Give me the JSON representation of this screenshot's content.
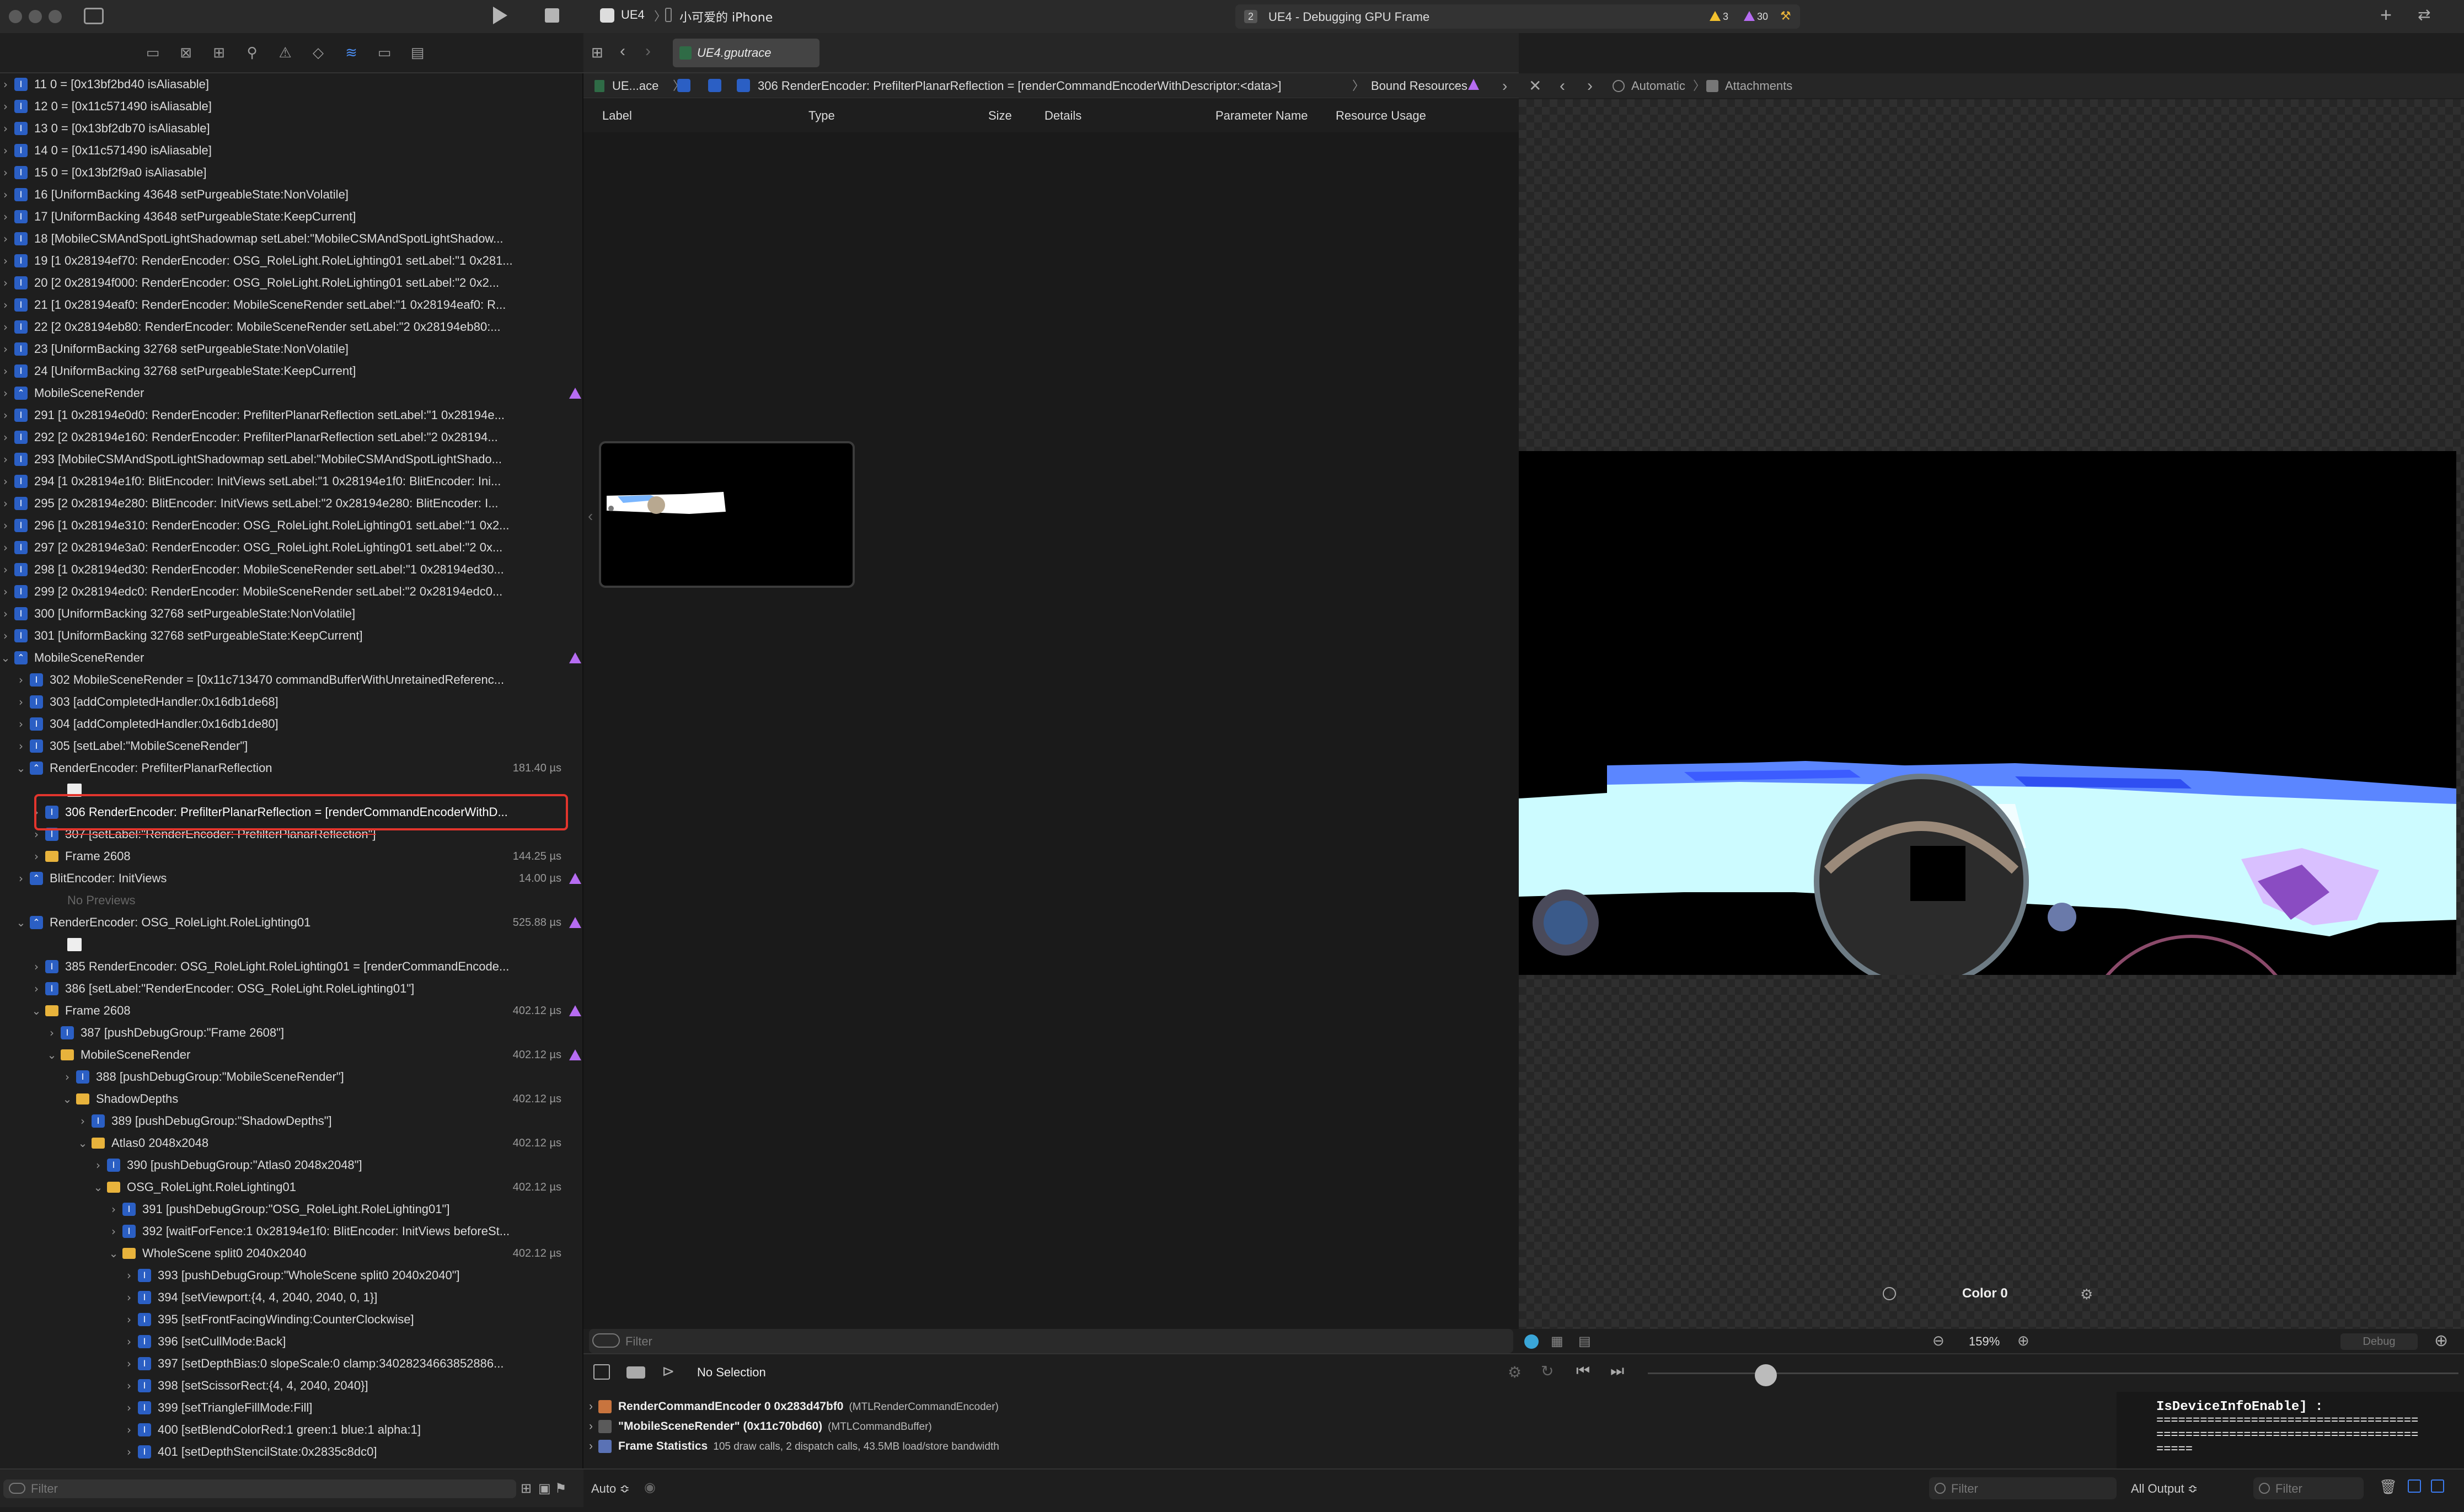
{
  "toolbar": {
    "scheme": "UE4",
    "device": "小可爱的 iPhone",
    "activity_num": "2",
    "activity": "UE4 - Debugging GPU Frame",
    "warnings": "3",
    "issues": "30"
  },
  "tab": {
    "title": "UE4.gputrace"
  },
  "breadcrumb": {
    "root": "UE...ace",
    "item": "306 RenderEncoder: PrefilterPlanarReflection = [renderCommandEncoderWithDescriptor:<data>]",
    "section": "Bound Resources"
  },
  "right_breadcrumb": {
    "mode": "Automatic",
    "item": "Attachments"
  },
  "columns": [
    "Label",
    "Type",
    "Size",
    "Details",
    "Parameter Name",
    "Resource Usage"
  ],
  "rows": [
    {
      "t": "11 0 = [0x13bf2bd40 isAliasable]",
      "d": 0,
      "i": "cmd"
    },
    {
      "t": "12 0 = [0x11c571490 isAliasable]",
      "d": 0,
      "i": "cmd"
    },
    {
      "t": "13 0 = [0x13bf2db70 isAliasable]",
      "d": 0,
      "i": "cmd"
    },
    {
      "t": "14 0 = [0x11c571490 isAliasable]",
      "d": 0,
      "i": "cmd"
    },
    {
      "t": "15 0 = [0x13bf2f9a0 isAliasable]",
      "d": 0,
      "i": "cmd"
    },
    {
      "t": "16 [UniformBacking 43648 setPurgeableState:NonVolatile]",
      "d": 0,
      "i": "cmd"
    },
    {
      "t": "17 [UniformBacking 43648 setPurgeableState:KeepCurrent]",
      "d": 0,
      "i": "cmd"
    },
    {
      "t": "18 [MobileCSMAndSpotLightShadowmap setLabel:\"MobileCSMAndSpotLightShadow...",
      "d": 0,
      "i": "cmd"
    },
    {
      "t": "19 [1 0x28194ef70: RenderEncoder: OSG_RoleLight.RoleLighting01 setLabel:\"1 0x281...",
      "d": 0,
      "i": "cmd"
    },
    {
      "t": "20 [2 0x28194f000: RenderEncoder: OSG_RoleLight.RoleLighting01 setLabel:\"2 0x2...",
      "d": 0,
      "i": "cmd"
    },
    {
      "t": "21 [1 0x28194eaf0: RenderEncoder: MobileSceneRender setLabel:\"1 0x28194eaf0: R...",
      "d": 0,
      "i": "cmd"
    },
    {
      "t": "22 [2 0x28194eb80: RenderEncoder: MobileSceneRender setLabel:\"2 0x28194eb80:...",
      "d": 0,
      "i": "cmd"
    },
    {
      "t": "23 [UniformBacking 32768 setPurgeableState:NonVolatile]",
      "d": 0,
      "i": "cmd"
    },
    {
      "t": "24 [UniformBacking 32768 setPurgeableState:KeepCurrent]",
      "d": 0,
      "i": "cmd"
    },
    {
      "t": "MobileSceneRender",
      "d": 0,
      "i": "enc",
      "w": true
    },
    {
      "t": "291 [1 0x28194e0d0: RenderEncoder: PrefilterPlanarReflection setLabel:\"1 0x28194e...",
      "d": 0,
      "i": "cmd"
    },
    {
      "t": "292 [2 0x28194e160: RenderEncoder: PrefilterPlanarReflection setLabel:\"2 0x28194...",
      "d": 0,
      "i": "cmd"
    },
    {
      "t": "293 [MobileCSMAndSpotLightShadowmap setLabel:\"MobileCSMAndSpotLightShado...",
      "d": 0,
      "i": "cmd"
    },
    {
      "t": "294 [1 0x28194e1f0: BlitEncoder: InitViews setLabel:\"1 0x28194e1f0: BlitEncoder: Ini...",
      "d": 0,
      "i": "cmd"
    },
    {
      "t": "295 [2 0x28194e280: BlitEncoder: InitViews setLabel:\"2 0x28194e280: BlitEncoder: I...",
      "d": 0,
      "i": "cmd"
    },
    {
      "t": "296 [1 0x28194e310: RenderEncoder: OSG_RoleLight.RoleLighting01 setLabel:\"1 0x2...",
      "d": 0,
      "i": "cmd"
    },
    {
      "t": "297 [2 0x28194e3a0: RenderEncoder: OSG_RoleLight.RoleLighting01 setLabel:\"2 0x...",
      "d": 0,
      "i": "cmd"
    },
    {
      "t": "298 [1 0x28194ed30: RenderEncoder: MobileSceneRender setLabel:\"1 0x28194ed30...",
      "d": 0,
      "i": "cmd"
    },
    {
      "t": "299 [2 0x28194edc0: RenderEncoder: MobileSceneRender setLabel:\"2 0x28194edc0...",
      "d": 0,
      "i": "cmd"
    },
    {
      "t": "300 [UniformBacking 32768 setPurgeableState:NonVolatile]",
      "d": 0,
      "i": "cmd"
    },
    {
      "t": "301 [UniformBacking 32768 setPurgeableState:KeepCurrent]",
      "d": 0,
      "i": "cmd"
    },
    {
      "t": "MobileSceneRender",
      "d": 0,
      "i": "enc",
      "w": true,
      "open": true
    },
    {
      "t": "302 MobileSceneRender = [0x11c713470 commandBufferWithUnretainedReferenc...",
      "d": 1,
      "i": "cmd"
    },
    {
      "t": "303 [addCompletedHandler:0x16db1de68]",
      "d": 1,
      "i": "cmd"
    },
    {
      "t": "304 [addCompletedHandler:0x16db1de80]",
      "d": 1,
      "i": "cmd"
    },
    {
      "t": "305 [setLabel:\"MobileSceneRender\"]",
      "d": 1,
      "i": "cmd"
    },
    {
      "t": "RenderEncoder: PrefilterPlanarReflection",
      "d": 1,
      "i": "enc",
      "dur": "181.40 µs",
      "open": true,
      "tall": true
    },
    {
      "t": "306 RenderEncoder: PrefilterPlanarReflection = [renderCommandEncoderWithD...",
      "d": 2,
      "i": "cmd",
      "sel": true
    },
    {
      "t": "307 [setLabel:\"RenderEncoder: PrefilterPlanarReflection\"]",
      "d": 2,
      "i": "cmd",
      "strike": true
    },
    {
      "t": "Frame 2608",
      "d": 2,
      "i": "fold",
      "dur": "144.25 µs"
    },
    {
      "t": "BlitEncoder: InitViews",
      "d": 1,
      "i": "enc",
      "dur": "14.00 µs",
      "w": true
    },
    {
      "t": "No Previews",
      "d": 1,
      "i": "none",
      "dim": true
    },
    {
      "t": "RenderEncoder: OSG_RoleLight.RoleLighting01",
      "d": 1,
      "i": "enc",
      "dur": "525.88 µs",
      "w": true,
      "open": true,
      "tall": true
    },
    {
      "t": "385 RenderEncoder: OSG_RoleLight.RoleLighting01 = [renderCommandEncode...",
      "d": 2,
      "i": "cmd"
    },
    {
      "t": "386 [setLabel:\"RenderEncoder: OSG_RoleLight.RoleLighting01\"]",
      "d": 2,
      "i": "cmd"
    },
    {
      "t": "Frame 2608",
      "d": 2,
      "i": "fold",
      "dur": "402.12 µs",
      "w": true,
      "open": true
    },
    {
      "t": "387 [pushDebugGroup:\"Frame 2608\"]",
      "d": 3,
      "i": "cmd"
    },
    {
      "t": "MobileSceneRender",
      "d": 3,
      "i": "fold",
      "dur": "402.12 µs",
      "w": true,
      "open": true
    },
    {
      "t": "388 [pushDebugGroup:\"MobileSceneRender\"]",
      "d": 4,
      "i": "cmd"
    },
    {
      "t": "ShadowDepths",
      "d": 4,
      "i": "fold",
      "dur": "402.12 µs",
      "open": true
    },
    {
      "t": "389 [pushDebugGroup:\"ShadowDepths\"]",
      "d": 5,
      "i": "cmd"
    },
    {
      "t": "Atlas0 2048x2048",
      "d": 5,
      "i": "fold",
      "dur": "402.12 µs",
      "open": true
    },
    {
      "t": "390 [pushDebugGroup:\"Atlas0 2048x2048\"]",
      "d": 6,
      "i": "cmd"
    },
    {
      "t": "OSG_RoleLight.RoleLighting01",
      "d": 6,
      "i": "fold",
      "dur": "402.12 µs",
      "open": true
    },
    {
      "t": "391 [pushDebugGroup:\"OSG_RoleLight.RoleLighting01\"]",
      "d": 7,
      "i": "cmd"
    },
    {
      "t": "392 [waitForFence:1 0x28194e1f0: BlitEncoder: InitViews beforeSt...",
      "d": 7,
      "i": "cmd"
    },
    {
      "t": "WholeScene split0 2040x2040",
      "d": 7,
      "i": "fold",
      "dur": "402.12 µs",
      "open": true
    },
    {
      "t": "393 [pushDebugGroup:\"WholeScene split0 2040x2040\"]",
      "d": 8,
      "i": "cmd"
    },
    {
      "t": "394 [setViewport:{4, 4, 2040, 2040, 0, 1}]",
      "d": 8,
      "i": "cmd"
    },
    {
      "t": "395 [setFrontFacingWinding:CounterClockwise]",
      "d": 8,
      "i": "cmd"
    },
    {
      "t": "396 [setCullMode:Back]",
      "d": 8,
      "i": "cmd"
    },
    {
      "t": "397 [setDepthBias:0 slopeScale:0 clamp:34028234663852886...",
      "d": 8,
      "i": "cmd"
    },
    {
      "t": "398 [setScissorRect:{4, 4, 2040, 2040}]",
      "d": 8,
      "i": "cmd"
    },
    {
      "t": "399 [setTriangleFillMode:Fill]",
      "d": 8,
      "i": "cmd"
    },
    {
      "t": "400 [setBlendColorRed:1 green:1 blue:1 alpha:1]",
      "d": 8,
      "i": "cmd"
    },
    {
      "t": "401 [setDepthStencilState:0x2835c8dc0]",
      "d": 8,
      "i": "cmd"
    }
  ],
  "filter": {
    "placeholder": "Filter"
  },
  "attachment": {
    "label": "Color 0",
    "zoom": "159%"
  },
  "debug": {
    "selection": "No Selection",
    "debug_label": "Debug"
  },
  "console": [
    {
      "name": "RenderCommandEncoder 0 0x283d47bf0",
      "type": "(MTLRenderCommandEncoder)"
    },
    {
      "name": "\"MobileSceneRender\" (0x11c70bd60)",
      "type": "(MTLCommandBuffer)"
    },
    {
      "name": "Frame Statistics",
      "type": "105 draw calls, 2 dispatch calls, 43.5MB load/store bandwidth"
    }
  ],
  "vars": {
    "line1": "IsDeviceInfoEnable] :",
    "line2": "====================================",
    "line3": "====================================",
    "line4": "====="
  },
  "bottom": {
    "auto": "Auto ≎",
    "all_output": "All Output ≎"
  }
}
